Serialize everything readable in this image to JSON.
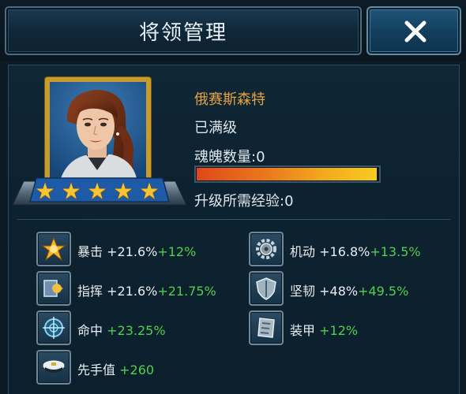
{
  "window": {
    "title": "将领管理",
    "close_icon": "close-x-icon"
  },
  "hero": {
    "portrait_icon": "general-portrait-female",
    "stars": 5,
    "name": "俄赛斯森特",
    "level_status": "已满级",
    "soul_label": "魂魄数量:",
    "soul_count": "0",
    "soul_bar_fraction": 0.99,
    "exp_label": "升级所需经验:",
    "exp_required": "0"
  },
  "attributes": [
    {
      "icon": "critical-hit-icon",
      "label": "暴击",
      "base": "+21.6%",
      "bonus": "+12%"
    },
    {
      "icon": "mobility-gear-icon",
      "label": "机动",
      "base": "+16.8%",
      "bonus": "+13.5%"
    },
    {
      "icon": "command-icon",
      "label": "指挥",
      "base": "+21.6%",
      "bonus": "+21.75%"
    },
    {
      "icon": "toughness-shield-icon",
      "label": "坚韧",
      "base": "+48%",
      "bonus": "+49.5%"
    },
    {
      "icon": "accuracy-crosshair-icon",
      "label": "命中",
      "base": "",
      "bonus": "+23.25%"
    },
    {
      "icon": "armor-plate-icon",
      "label": "装甲",
      "base": "",
      "bonus": "+12%"
    },
    {
      "icon": "initiative-cap-icon",
      "label": "先手值",
      "base": "",
      "bonus": "+260"
    }
  ],
  "colors": {
    "name": "#e4a23f",
    "bonus": "#4fd04f",
    "frame_gold": "#c99a2e",
    "star": "#f7c531"
  }
}
